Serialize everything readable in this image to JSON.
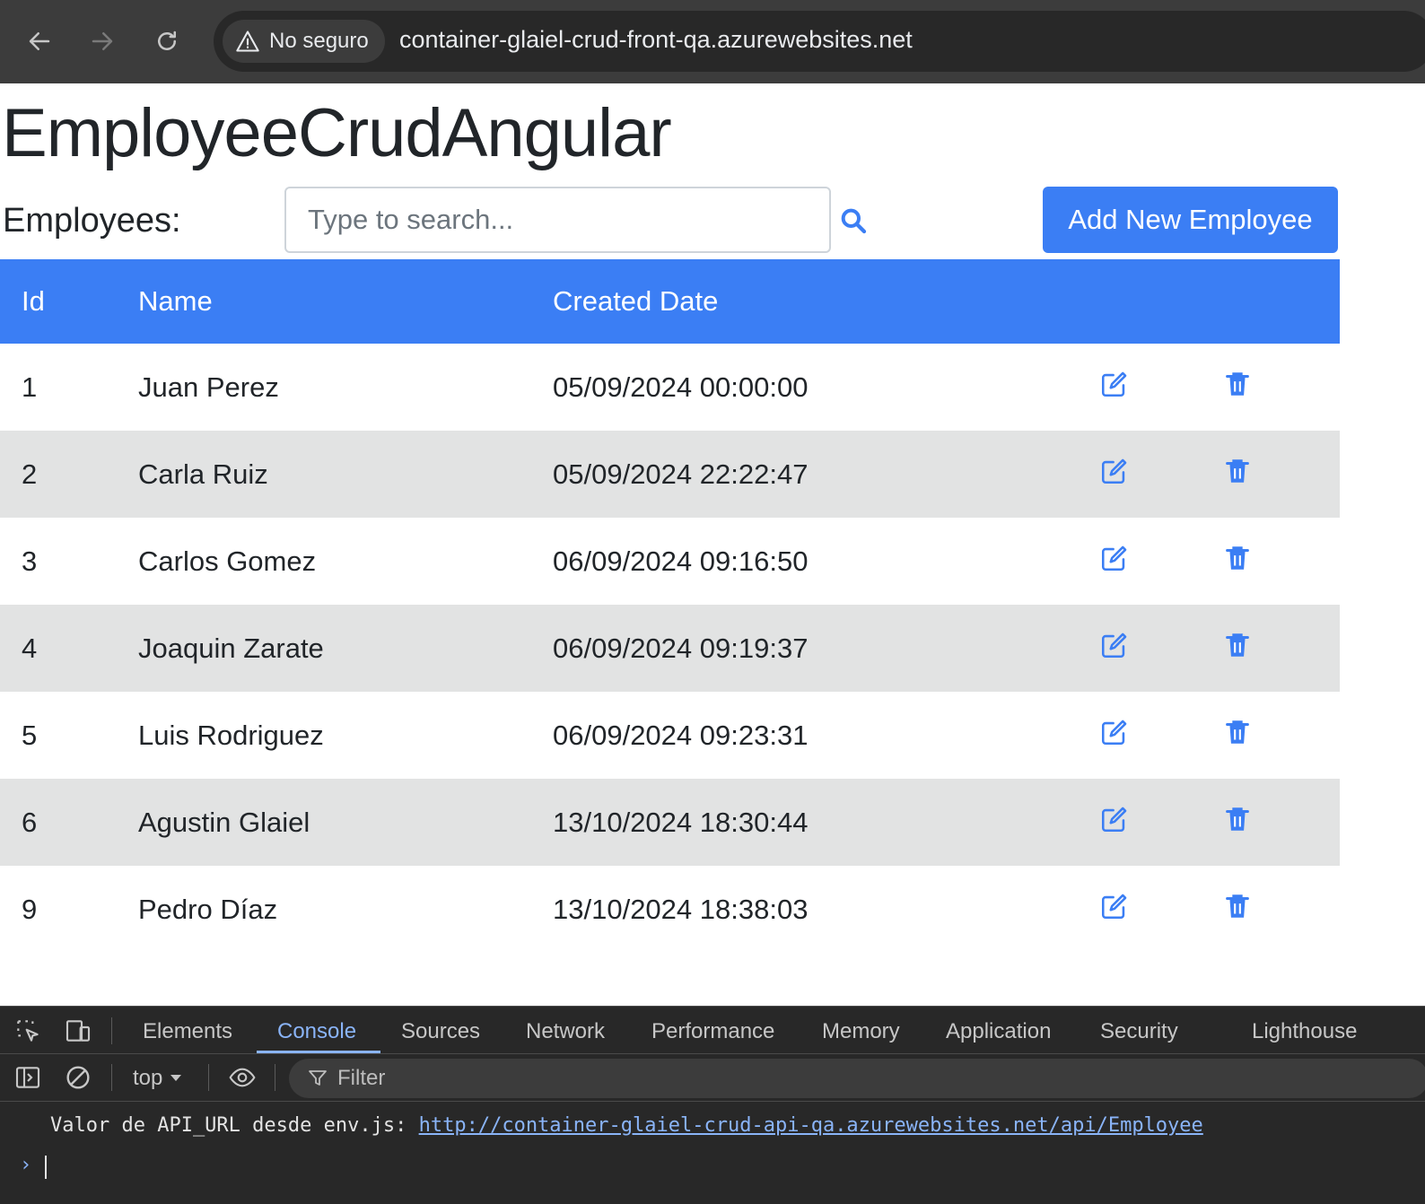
{
  "browser": {
    "security_label": "No seguro",
    "url": "container-glaiel-crud-front-qa.azurewebsites.net"
  },
  "app": {
    "title": "EmployeeCrudAngular",
    "employees_label": "Employees:",
    "search_placeholder": "Type to search...",
    "add_button": "Add New Employee",
    "accent_color": "#3b7ef4"
  },
  "table": {
    "headers": [
      "Id",
      "Name",
      "Created Date"
    ],
    "rows": [
      {
        "id": "1",
        "name": "Juan Perez",
        "created": "05/09/2024 00:00:00"
      },
      {
        "id": "2",
        "name": "Carla Ruiz",
        "created": "05/09/2024 22:22:47"
      },
      {
        "id": "3",
        "name": "Carlos Gomez",
        "created": "06/09/2024 09:16:50"
      },
      {
        "id": "4",
        "name": "Joaquin Zarate",
        "created": "06/09/2024 09:19:37"
      },
      {
        "id": "5",
        "name": "Luis Rodriguez",
        "created": "06/09/2024 09:23:31"
      },
      {
        "id": "6",
        "name": "Agustin Glaiel",
        "created": "13/10/2024 18:30:44"
      },
      {
        "id": "9",
        "name": "Pedro Díaz",
        "created": "13/10/2024 18:38:03"
      }
    ],
    "row_icons": [
      "edit-icon",
      "trash-icon"
    ]
  },
  "devtools": {
    "tabs": [
      "Elements",
      "Console",
      "Sources",
      "Network",
      "Performance",
      "Memory",
      "Application",
      "Security",
      "Lighthouse"
    ],
    "active_tab": "Console",
    "context": "top",
    "filter_placeholder": "Filter",
    "console_message": "Valor de API_URL desde env.js: ",
    "console_link": "http://container-glaiel-crud-api-qa.azurewebsites.net/api/Employee",
    "prompt": "›"
  }
}
